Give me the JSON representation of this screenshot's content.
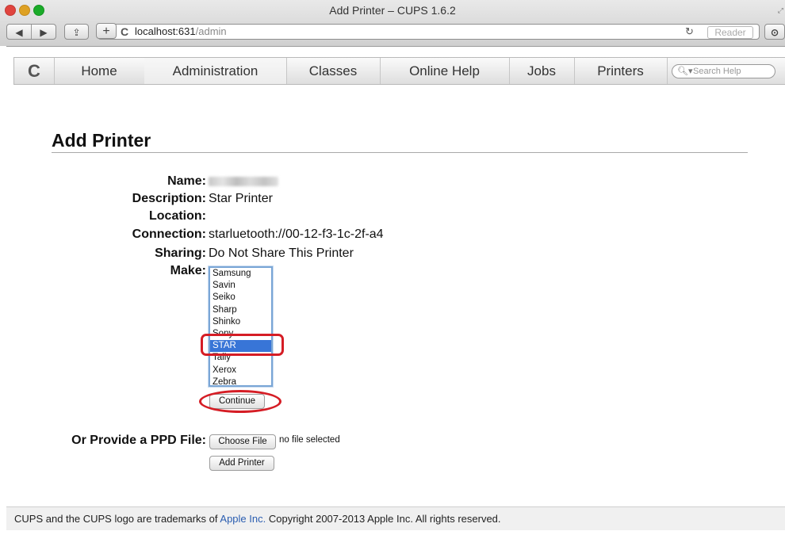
{
  "window": {
    "title": "Add Printer – CUPS 1.6.2"
  },
  "browser": {
    "url_host": "localhost:631",
    "url_path": "/admin",
    "reader_label": "Reader"
  },
  "nav": {
    "items": [
      "Home",
      "Administration",
      "Classes",
      "Online Help",
      "Jobs",
      "Printers"
    ],
    "active": "Administration",
    "search_placeholder": "Search Help"
  },
  "page": {
    "title": "Add Printer",
    "fields": {
      "name_label": "Name:",
      "description_label": "Description:",
      "description_value": "Star Printer",
      "location_label": "Location:",
      "location_value": "",
      "connection_label": "Connection:",
      "connection_value": "starluetooth://00-12-f3-1c-2f-a4",
      "sharing_label": "Sharing:",
      "sharing_value": "Do Not Share This Printer",
      "make_label": "Make:"
    },
    "make_options": [
      "Samsung",
      "Savin",
      "Seiko",
      "Sharp",
      "Shinko",
      "Sony",
      "STAR",
      "Tally",
      "Xerox",
      "Zebra"
    ],
    "make_selected": "STAR",
    "continue_label": "Continue",
    "ppd_label": "Or Provide a PPD File:",
    "choose_file_label": "Choose File",
    "no_file_text": "no file selected",
    "add_printer_label": "Add Printer"
  },
  "footer": {
    "text_before": "CUPS and the CUPS logo are trademarks of ",
    "link": "Apple Inc.",
    "text_after": " Copyright 2007-2013 Apple Inc. All rights reserved."
  },
  "colors": {
    "selection": "#3875d7",
    "annotation": "#d51d25",
    "link": "#2a5db0"
  }
}
